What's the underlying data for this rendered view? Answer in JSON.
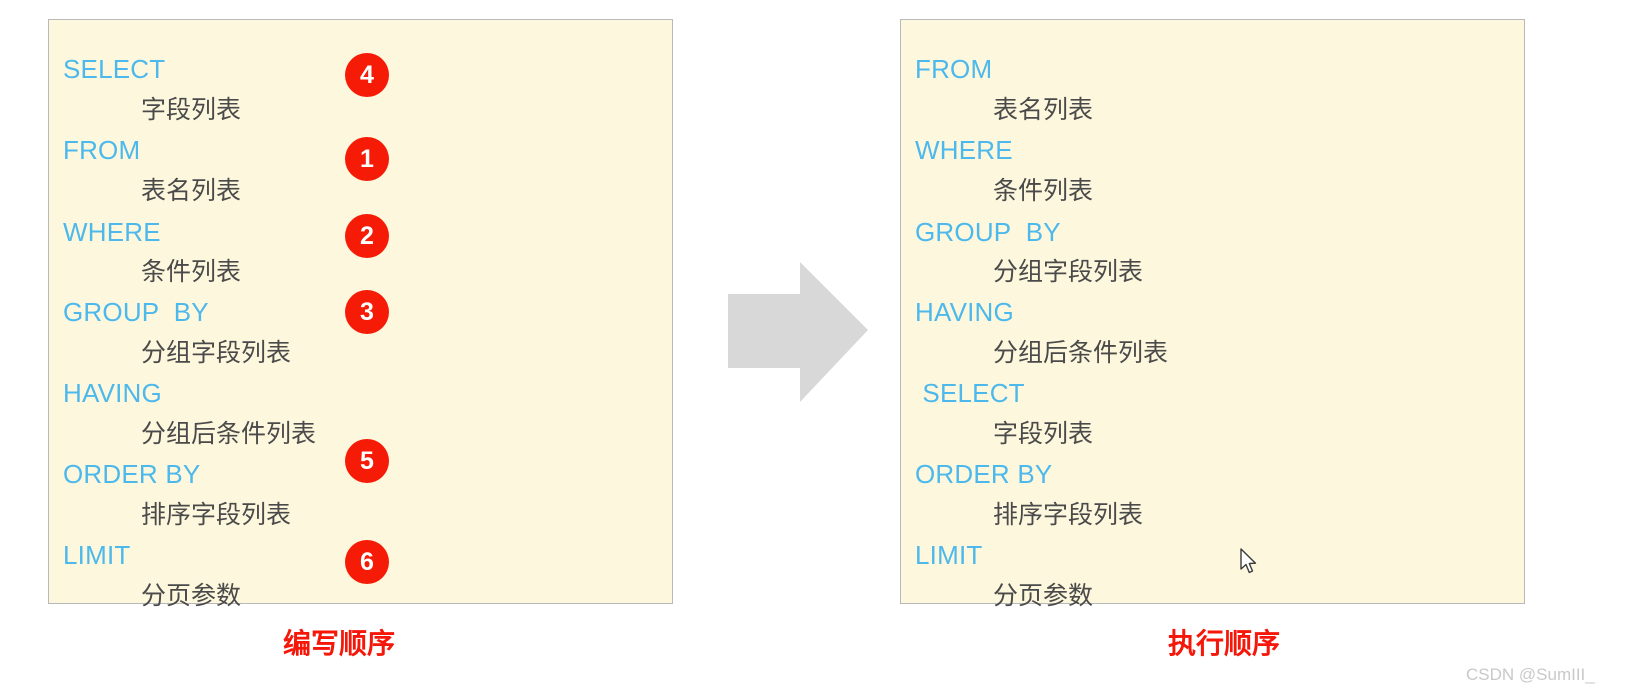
{
  "colors": {
    "panel_background": "#fdf8dd",
    "panel_border": "#b9b9b9",
    "keyword": "#4cb8ec",
    "value_text": "#4a4a4a",
    "badge": "#f51b06",
    "badge_label": "#ffffff",
    "caption": "#f5180a",
    "arrow": "#d8d8d8",
    "watermark": "#c9c9c9",
    "page_background": "#ffffff"
  },
  "left_panel": {
    "caption": "编写顺序",
    "clauses": [
      {
        "keyword": "SELECT",
        "value": "字段列表",
        "badge": "4"
      },
      {
        "keyword": "FROM",
        "value": "表名列表",
        "badge": "1"
      },
      {
        "keyword": "WHERE",
        "value": "条件列表",
        "badge": "2"
      },
      {
        "keyword": "GROUP  BY",
        "value": "分组字段列表",
        "badge": "3"
      },
      {
        "keyword": "HAVING",
        "value": "分组后条件列表",
        "badge": ""
      },
      {
        "keyword": "ORDER BY",
        "value": "排序字段列表",
        "badge": "5"
      },
      {
        "keyword": "LIMIT",
        "value": "分页参数",
        "badge": "6"
      }
    ]
  },
  "right_panel": {
    "caption": "执行顺序",
    "clauses": [
      {
        "keyword": "FROM",
        "value": "表名列表"
      },
      {
        "keyword": "WHERE",
        "value": "条件列表"
      },
      {
        "keyword": "GROUP  BY",
        "value": "分组字段列表"
      },
      {
        "keyword": "HAVING",
        "value": "分组后条件列表"
      },
      {
        "keyword": " SELECT",
        "value": "字段列表"
      },
      {
        "keyword": "ORDER BY",
        "value": "排序字段列表"
      },
      {
        "keyword": "LIMIT",
        "value": "分页参数"
      }
    ]
  },
  "arrow": {
    "icon": "arrow-right-icon",
    "direction": "right"
  },
  "cursor": {
    "icon": "mouse-pointer-icon"
  },
  "watermark": {
    "text": "CSDN @SumIII_"
  }
}
